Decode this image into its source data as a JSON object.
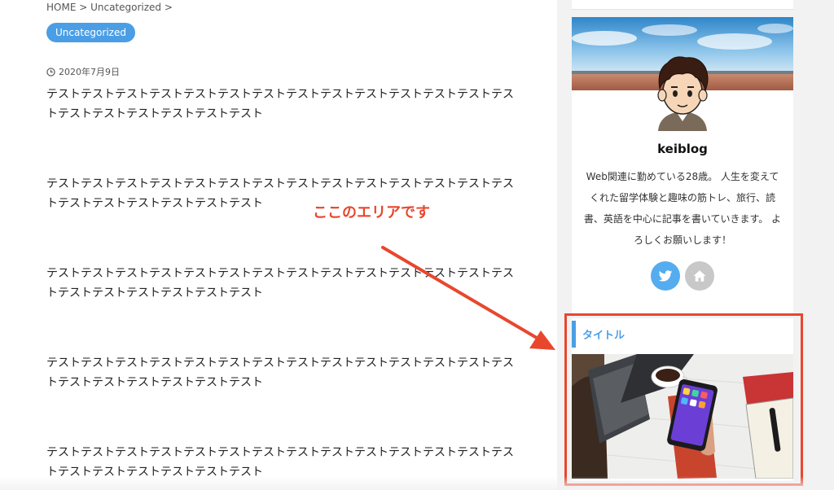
{
  "breadcrumb": {
    "text": "HOME > Uncategorized >"
  },
  "post": {
    "category": "Uncategorized",
    "date": "2020年7月9日",
    "paragraphs": [
      "テストテストテストテストテストテストテストテストテストテストテストテストテストテストテストテストテストテストテストテスト",
      "テストテストテストテストテストテストテストテストテストテストテストテストテストテストテストテストテストテストテストテスト",
      "テストテストテストテストテストテストテストテストテストテストテストテストテストテストテストテストテストテストテストテスト",
      "テストテストテストテストテストテストテストテストテストテストテストテストテストテストテストテストテストテストテストテスト",
      "テストテストテストテストテストテストテストテストテストテストテストテストテストテストテストテストテストテストテストテスト"
    ]
  },
  "profile": {
    "name": "keiblog",
    "bio": "Web関連に勤めている28歳。 人生を変えてくれた留学体験と趣味の筋トレ、旅行、読書、英語を中心に記事を書いていきます。 よろしくお願いします！",
    "sns": [
      {
        "icon": "twitter-icon",
        "color": "#55acee"
      },
      {
        "icon": "home-icon",
        "color": "#c8c8c8"
      }
    ]
  },
  "widget": {
    "title": "タイトル"
  },
  "annotation": {
    "label": "ここのエリアです",
    "color": "#e8472e"
  },
  "colors": {
    "accent": "#4a9ee6",
    "highlight": "#e8472e",
    "background": "#f2f2f2"
  }
}
